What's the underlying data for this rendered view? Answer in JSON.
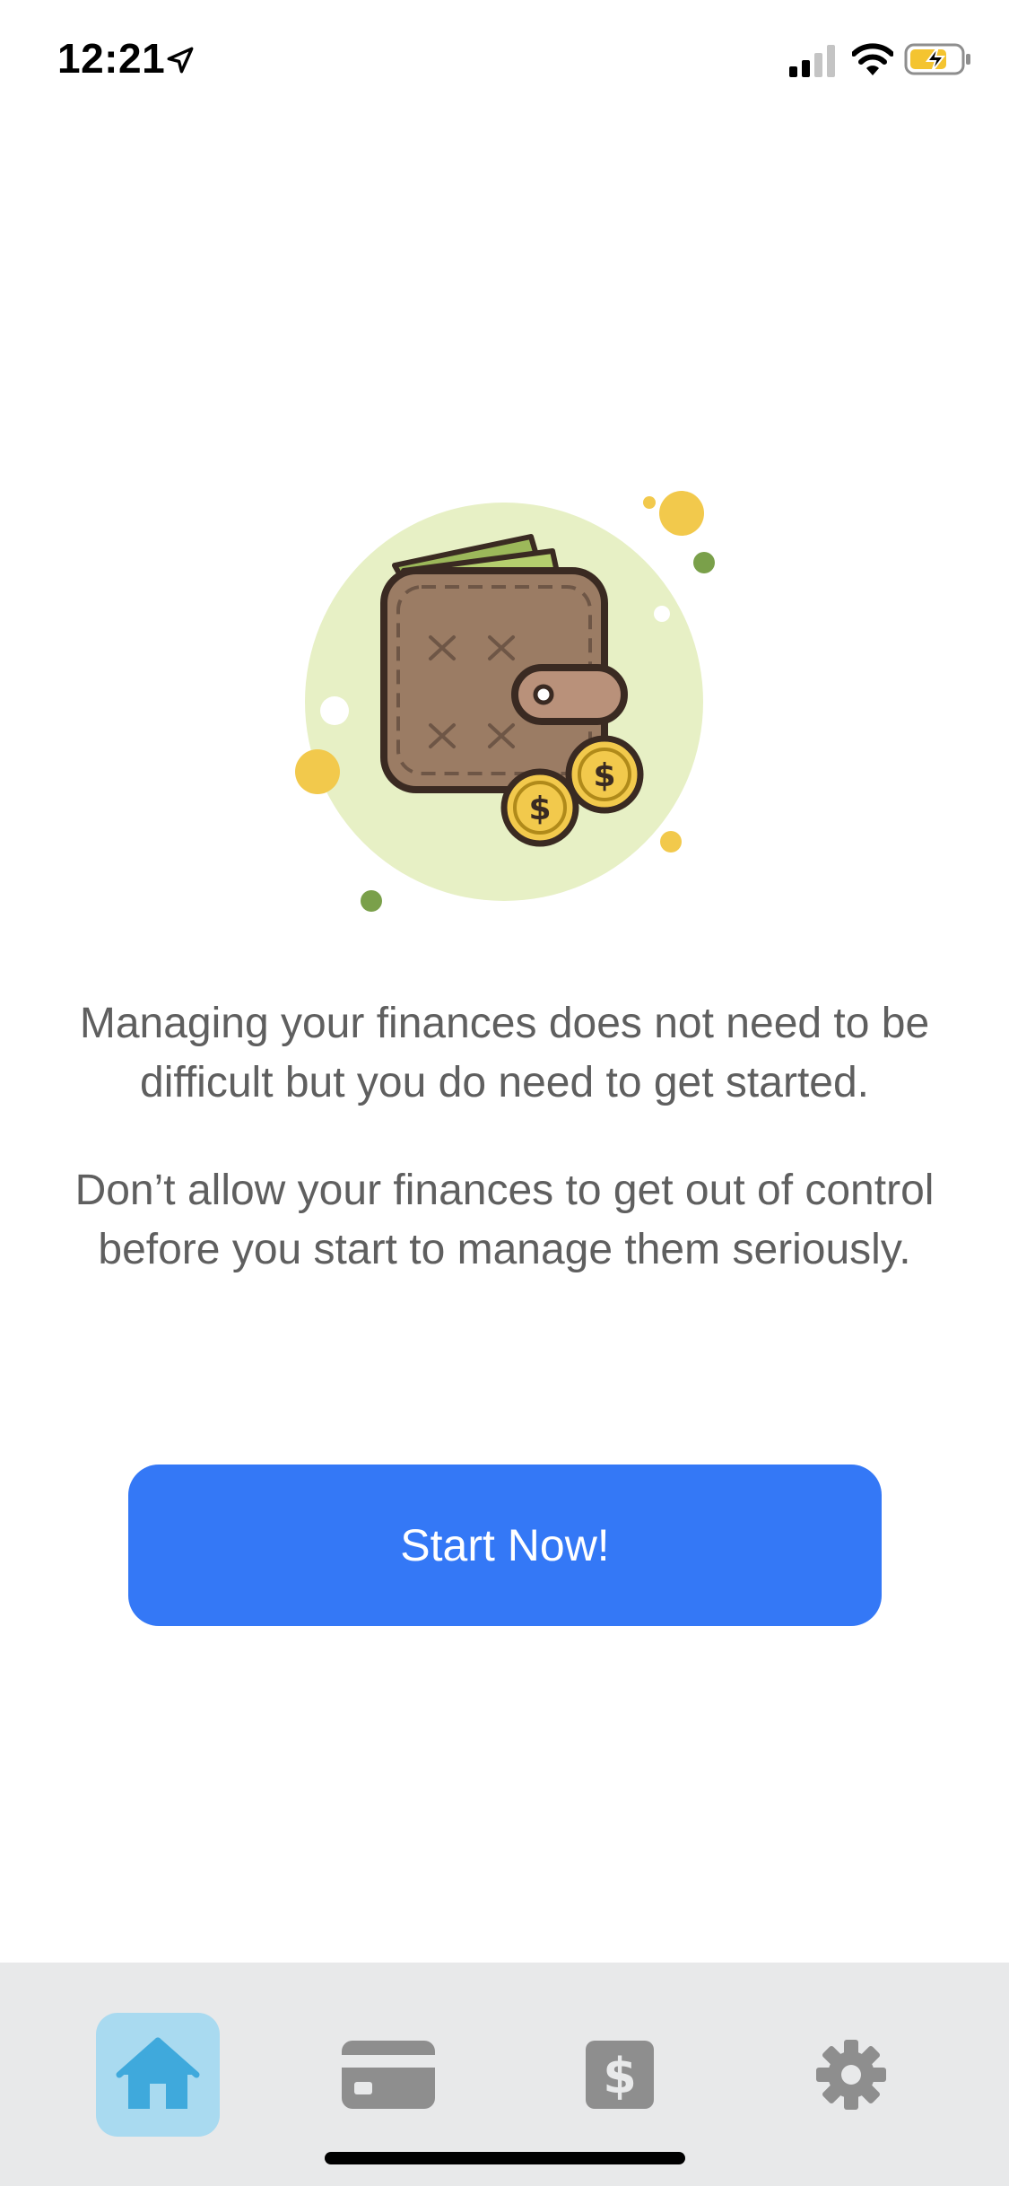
{
  "status_bar": {
    "time": "12:21",
    "icons": [
      "location-arrow-icon",
      "cellular-signal-icon",
      "wifi-icon",
      "battery-charging-icon"
    ]
  },
  "illustration": {
    "name": "wallet-with-coins-icon",
    "colors": {
      "circle": "#e7f0c5",
      "wallet": "#9b7c64",
      "outline": "#3a2a22",
      "coin": "#f4c84a",
      "dot_green": "#7aa04a"
    }
  },
  "content": {
    "intro_line_1": "Managing your finances does not need to be difficult but you do need to get started.",
    "intro_line_2": "Don’t allow your finances to get out of control before you start to manage them seriously."
  },
  "button": {
    "start_label": "Start Now!",
    "color": "#3478f6"
  },
  "tab_bar": {
    "tabs": [
      {
        "icon": "home-icon",
        "selected": true
      },
      {
        "icon": "credit-card-icon",
        "selected": false
      },
      {
        "icon": "dollar-icon",
        "selected": false
      },
      {
        "icon": "gear-icon",
        "selected": false
      }
    ],
    "selected_color": "#3fa9dc",
    "unselected_color": "#8e8e8e"
  }
}
